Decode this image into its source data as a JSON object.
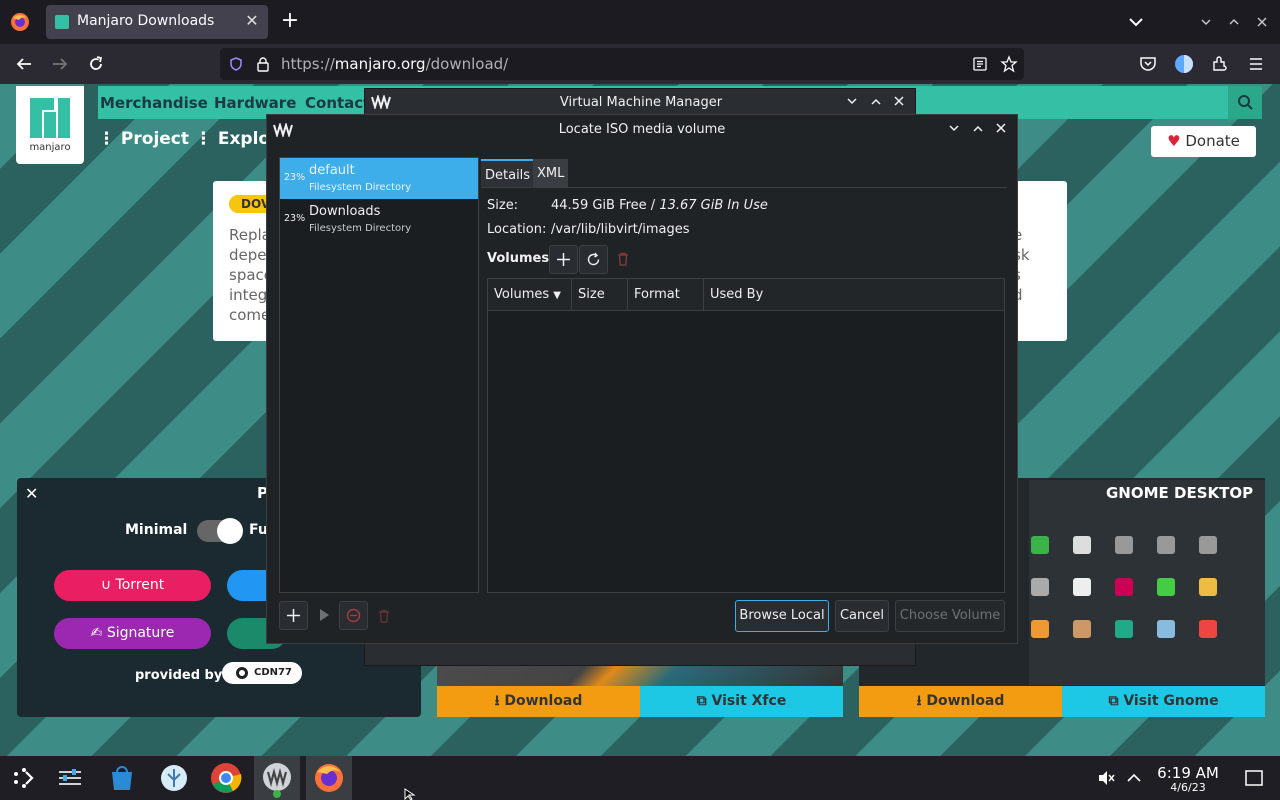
{
  "browser": {
    "tab_title": "Manjaro Downloads",
    "url_host": "https://manjaro.org",
    "url_path": "/download/",
    "url_prefix": "https://",
    "url_domain": "manjaro.org"
  },
  "website": {
    "nav": [
      "Merchandise",
      "Hardware",
      "Contact"
    ],
    "logo_text": "manjaro",
    "subnav": "⋮ Project   ⋮ Explo",
    "donate": "Donate",
    "card_badge": "DOV",
    "card_text_left": "Repla\ndepe\nspace\ninteg\ncome",
    "card_text_right": "e\nsk\ns\nd",
    "panel_head": "P",
    "toggle_minimal": "Minimal",
    "toggle_full": "Ful",
    "torrent": "Torrent",
    "signature": "Signature",
    "provided_by": "provided by",
    "cdn": "CDN77",
    "gnome_title": "GNOME DESKTOP",
    "xfce_download": "Download",
    "xfce_visit": "Visit Xfce",
    "gnome_download": "Download",
    "gnome_visit": "Visit Gnome"
  },
  "vmm": {
    "title": "Virtual Machine Manager"
  },
  "dialog": {
    "title": "Locate ISO media volume",
    "pools": [
      {
        "percent": "23%",
        "name": "default",
        "type": "Filesystem Directory",
        "selected": true
      },
      {
        "percent": "23%",
        "name": "Downloads",
        "type": "Filesystem Directory",
        "selected": false
      }
    ],
    "tabs": [
      "Details",
      "XML"
    ],
    "size_label": "Size:",
    "size_free": "44.59 GiB Free / ",
    "size_used": "13.67 GiB In Use",
    "location_label": "Location:",
    "location_value": "/var/lib/libvirt/images",
    "volumes_label": "Volumes",
    "columns": [
      "Volumes",
      "Size",
      "Format",
      "Used By"
    ],
    "browse_local": "Browse Local",
    "cancel": "Cancel",
    "choose_volume": "Choose Volume"
  },
  "taskbar": {
    "time": "6:19 AM",
    "date": "4/6/23"
  },
  "colors": {
    "selection": "#3daee9",
    "manjaro_green": "#35bfa4",
    "torrent": "#e91e63",
    "signature": "#9c27b0",
    "download_orange": "#f39c12",
    "visit_cyan": "#1cc8e3"
  }
}
